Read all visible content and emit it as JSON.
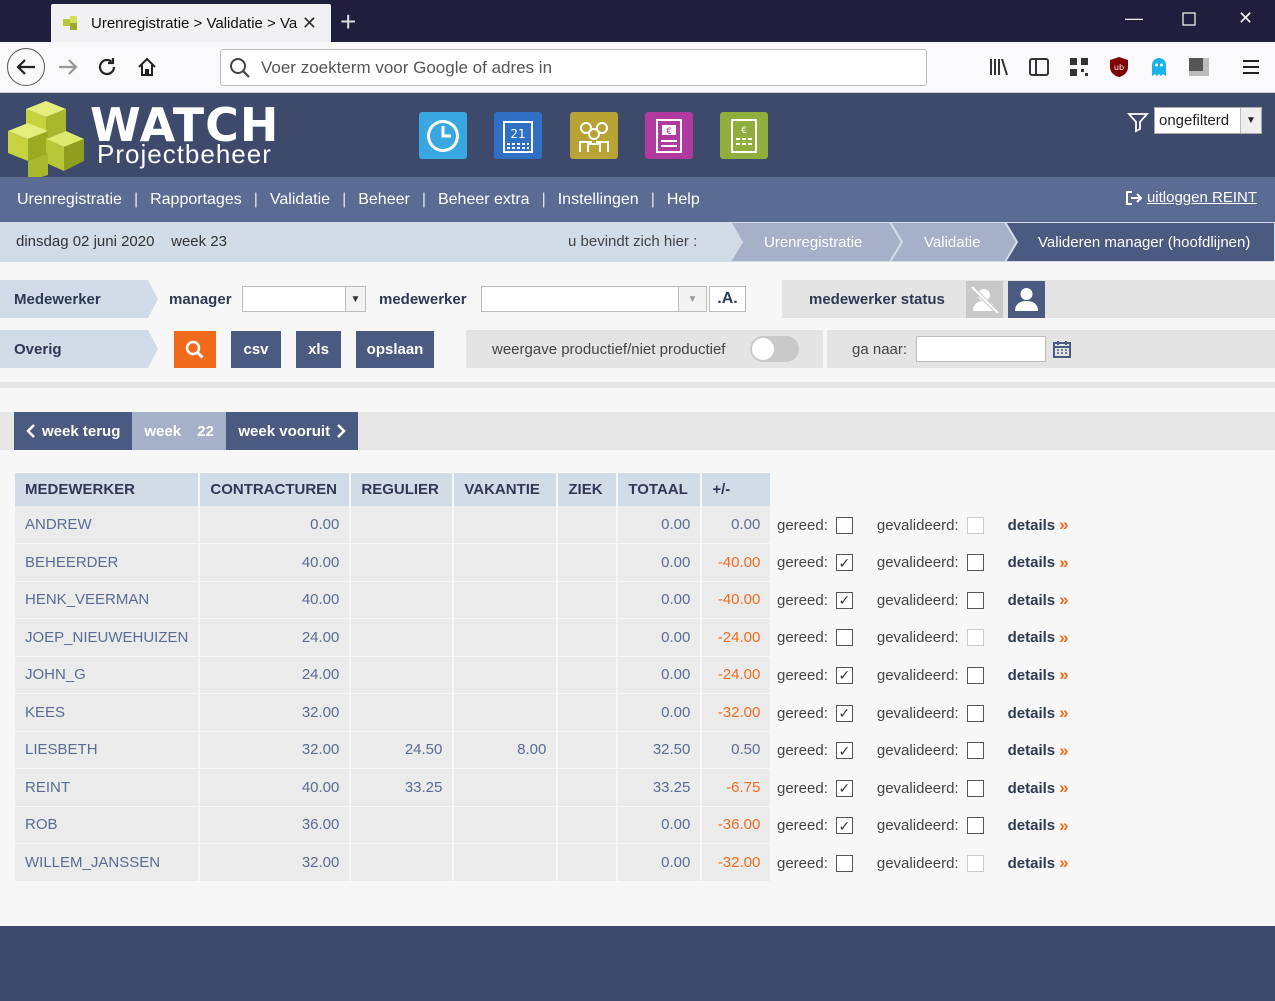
{
  "browser": {
    "tab_title": "Urenregistratie > Validatie > Va",
    "url_placeholder": "Voer zoekterm voor Google of adres in"
  },
  "app": {
    "logo_title": "WATCH",
    "logo_subtitle": "Projectbeheer",
    "filter_value": "ongefilterd",
    "menu": [
      "Urenregistratie",
      "Rapportages",
      "Validatie",
      "Beheer",
      "Beheer extra",
      "Instellingen",
      "Help"
    ],
    "logout": "uitloggen REINT",
    "date": "dinsdag 02 juni 2020",
    "week": "week 23",
    "here": "u bevindt zich hier :",
    "breadcrumb": [
      "Urenregistratie",
      "Validatie",
      "Valideren manager (hoofdlijnen)"
    ]
  },
  "filters": {
    "row1_label": "Medewerker",
    "manager_label": "manager",
    "medewerker_label": "medewerker",
    "a_button": ".A.",
    "status_label": "medewerker status",
    "row2_label": "Overig",
    "csv": "csv",
    "xls": "xls",
    "opslaan": "opslaan",
    "toggle_label": "weergave productief/niet productief",
    "ganaar_label": "ga naar:"
  },
  "weeknav": {
    "back": "week terug",
    "current_label": "week",
    "current_num": "22",
    "forward": "week vooruit"
  },
  "table": {
    "headers": [
      "MEDEWERKER",
      "CONTRACTUREN",
      "REGULIER",
      "VAKANTIE",
      "ZIEK",
      "TOTAAL",
      "+/-"
    ],
    "rows": [
      {
        "name": "ANDREW",
        "contract": "0.00",
        "regulier": "",
        "vakantie": "",
        "ziek": "",
        "totaal": "0.00",
        "diff": "0.00",
        "gereed": false,
        "gevalideerd": false,
        "gev_disabled": true
      },
      {
        "name": "BEHEERDER",
        "contract": "40.00",
        "regulier": "",
        "vakantie": "",
        "ziek": "",
        "totaal": "0.00",
        "diff": "-40.00",
        "gereed": true,
        "gevalideerd": false,
        "gev_disabled": false
      },
      {
        "name": "HENK_VEERMAN",
        "contract": "40.00",
        "regulier": "",
        "vakantie": "",
        "ziek": "",
        "totaal": "0.00",
        "diff": "-40.00",
        "gereed": true,
        "gevalideerd": false,
        "gev_disabled": false
      },
      {
        "name": "JOEP_NIEUWEHUIZEN",
        "contract": "24.00",
        "regulier": "",
        "vakantie": "",
        "ziek": "",
        "totaal": "0.00",
        "diff": "-24.00",
        "gereed": false,
        "gevalideerd": false,
        "gev_disabled": true
      },
      {
        "name": "JOHN_G",
        "contract": "24.00",
        "regulier": "",
        "vakantie": "",
        "ziek": "",
        "totaal": "0.00",
        "diff": "-24.00",
        "gereed": true,
        "gevalideerd": false,
        "gev_disabled": false
      },
      {
        "name": "KEES",
        "contract": "32.00",
        "regulier": "",
        "vakantie": "",
        "ziek": "",
        "totaal": "0.00",
        "diff": "-32.00",
        "gereed": true,
        "gevalideerd": false,
        "gev_disabled": false
      },
      {
        "name": "LIESBETH",
        "contract": "32.00",
        "regulier": "24.50",
        "vakantie": "8.00",
        "ziek": "",
        "totaal": "32.50",
        "diff": "0.50",
        "gereed": true,
        "gevalideerd": false,
        "gev_disabled": false
      },
      {
        "name": "REINT",
        "contract": "40.00",
        "regulier": "33.25",
        "vakantie": "",
        "ziek": "",
        "totaal": "33.25",
        "diff": "-6.75",
        "gereed": true,
        "gevalideerd": false,
        "gev_disabled": false
      },
      {
        "name": "ROB",
        "contract": "36.00",
        "regulier": "",
        "vakantie": "",
        "ziek": "",
        "totaal": "0.00",
        "diff": "-36.00",
        "gereed": true,
        "gevalideerd": false,
        "gev_disabled": false
      },
      {
        "name": "WILLEM_JANSSEN",
        "contract": "32.00",
        "regulier": "",
        "vakantie": "",
        "ziek": "",
        "totaal": "0.00",
        "diff": "-32.00",
        "gereed": false,
        "gevalideerd": false,
        "gev_disabled": true
      }
    ],
    "gereed_label": "gereed:",
    "gevalideerd_label": "gevalideerd:",
    "details_label": "details",
    "details_chevron": "»"
  },
  "colors": {
    "header_bg": "#3d4a6b",
    "menu_bg": "#5a6c93",
    "accent": "#f26b1d",
    "light_blue": "#d2dbe8"
  }
}
